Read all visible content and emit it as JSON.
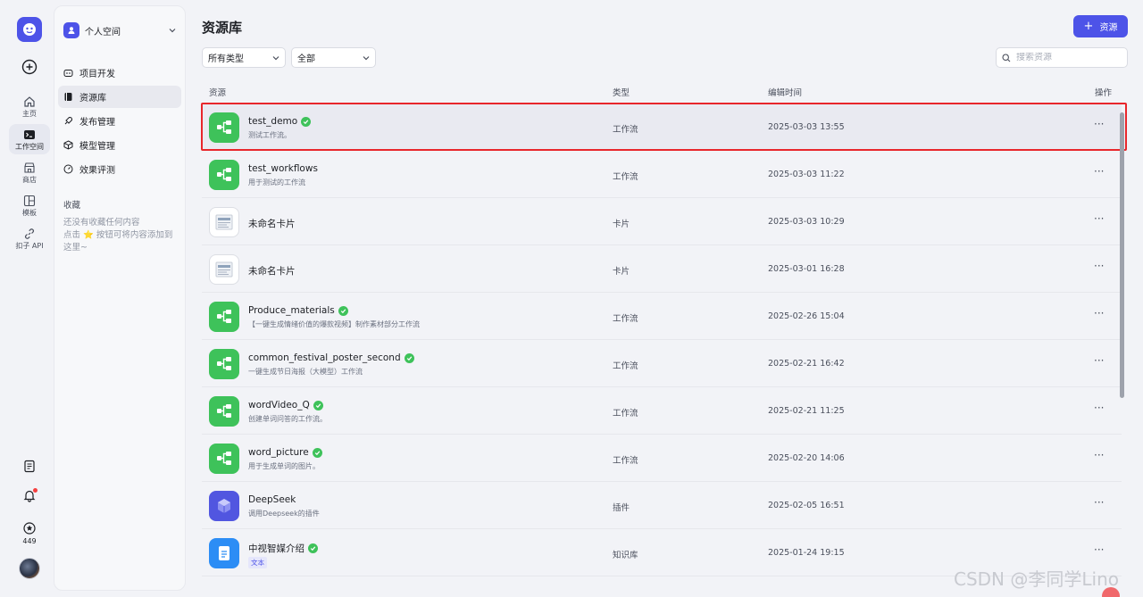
{
  "rail": {
    "items": [
      {
        "label": "主页",
        "icon": "home-icon"
      },
      {
        "label": "工作空间",
        "icon": "terminal-icon"
      },
      {
        "label": "商店",
        "icon": "store-icon"
      },
      {
        "label": "模板",
        "icon": "layout-icon"
      },
      {
        "label": "扣子 API",
        "icon": "link-icon"
      }
    ],
    "credits": "449"
  },
  "panel": {
    "space_name": "个人空间",
    "nav": [
      {
        "label": "项目开发",
        "icon": "robot-icon"
      },
      {
        "label": "资源库",
        "icon": "library-icon"
      },
      {
        "label": "发布管理",
        "icon": "rocket-icon"
      },
      {
        "label": "模型管理",
        "icon": "cube-icon"
      },
      {
        "label": "效果评测",
        "icon": "gauge-icon"
      }
    ],
    "favorites_title": "收藏",
    "favorites_empty_line1": "还没有收藏任何内容",
    "favorites_empty_line2": "点击 ⭐ 按钮可将内容添加到这里~"
  },
  "main": {
    "title": "资源库",
    "add_button": "资源",
    "filter_type": "所有类型",
    "filter_scope": "全部",
    "search_placeholder": "搜索资源",
    "columns": {
      "resource": "资源",
      "type": "类型",
      "edited": "编辑时间",
      "actions": "操作"
    },
    "rows": [
      {
        "name": "test_demo",
        "desc": "测试工作流。",
        "type": "工作流",
        "time": "2025-03-03 13:55",
        "kind": "workflow",
        "published": true
      },
      {
        "name": "test_workflows",
        "desc": "用于测试的工作流",
        "type": "工作流",
        "time": "2025-03-03 11:22",
        "kind": "workflow",
        "published": false
      },
      {
        "name": "未命名卡片",
        "desc": "",
        "type": "卡片",
        "time": "2025-03-03 10:29",
        "kind": "card",
        "published": false
      },
      {
        "name": "未命名卡片",
        "desc": "",
        "type": "卡片",
        "time": "2025-03-01 16:28",
        "kind": "card",
        "published": false
      },
      {
        "name": "Produce_materials",
        "desc": "【一键生成情绪价值的爆款视频】制作素材部分工作流",
        "type": "工作流",
        "time": "2025-02-26 15:04",
        "kind": "workflow",
        "published": true
      },
      {
        "name": "common_festival_poster_second",
        "desc": "一键生成节日海报（大模型）工作流",
        "type": "工作流",
        "time": "2025-02-21 16:42",
        "kind": "workflow",
        "published": true
      },
      {
        "name": "wordVideo_Q",
        "desc": "创建单词问答的工作流。",
        "type": "工作流",
        "time": "2025-02-21 11:25",
        "kind": "workflow",
        "published": true
      },
      {
        "name": "word_picture",
        "desc": "用于生成单词的图片。",
        "type": "工作流",
        "time": "2025-02-20 14:06",
        "kind": "workflow",
        "published": true
      },
      {
        "name": "DeepSeek",
        "desc": "调用Deepseek的插件",
        "type": "插件",
        "time": "2025-02-05 16:51",
        "kind": "plugin",
        "published": false
      },
      {
        "name": "中视智媒介绍",
        "desc": "",
        "tag": "文本",
        "type": "知识库",
        "time": "2025-01-24 19:15",
        "kind": "knowledge",
        "published": true
      }
    ],
    "more_glyph": "···"
  },
  "watermark": "CSDN @李同学Lino",
  "colors": {
    "accent": "#4d53e8",
    "workflow": "#3ec25a",
    "highlight_border": "#e8262b"
  }
}
